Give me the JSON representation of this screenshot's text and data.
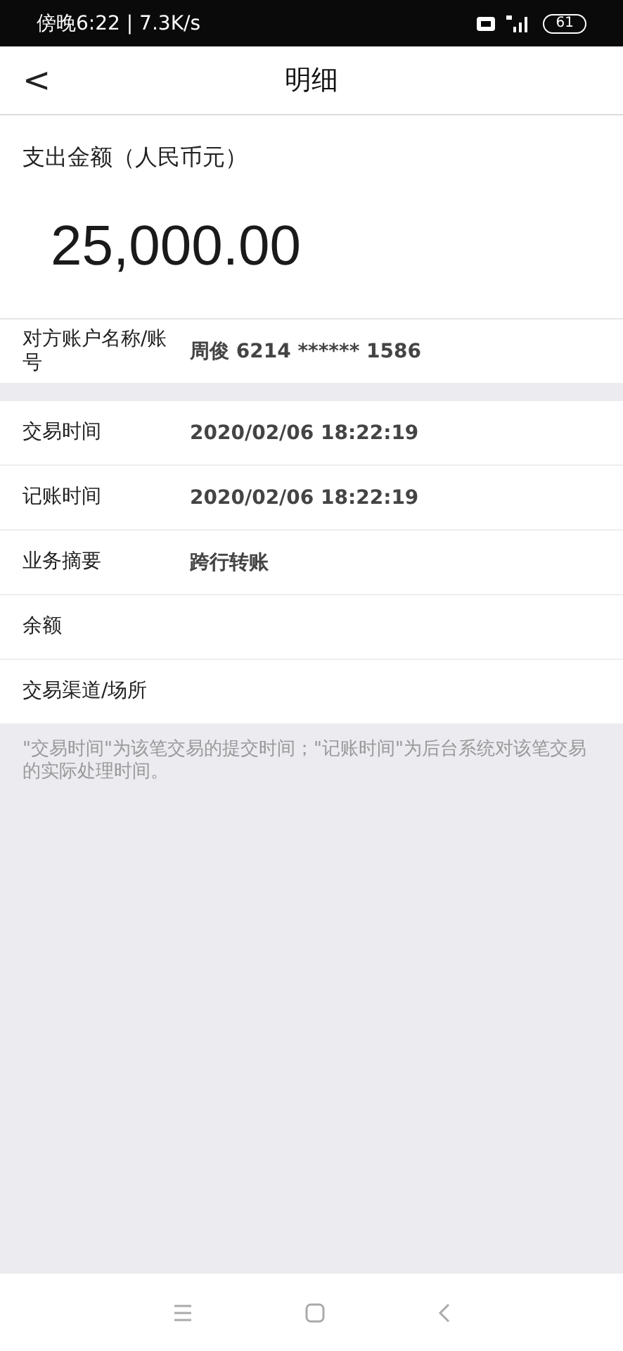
{
  "status_bar": {
    "time": "傍晚6:22 | 7.3K/s",
    "battery": "61"
  },
  "header": {
    "back": "<",
    "title": "明细"
  },
  "amount": {
    "label": "支出金额（人民币元）",
    "value": "25,000.00"
  },
  "groups": [
    [
      {
        "label": "对方账户名称/账号",
        "value": "周俊 6214 ****** 1586"
      }
    ],
    [
      {
        "label": "交易时间",
        "value": "2020/02/06  18:22:19"
      },
      {
        "label": "记账时间",
        "value": "2020/02/06  18:22:19"
      },
      {
        "label": "业务摘要",
        "value": "跨行转账"
      },
      {
        "label": "余额"
      },
      {
        "label": "交易渠道/场所"
      }
    ]
  ],
  "note": "\"交易时间\"为该笔交易的提交时间；\"记账时间\"为后台系统对该笔交易的实际处理时间。"
}
